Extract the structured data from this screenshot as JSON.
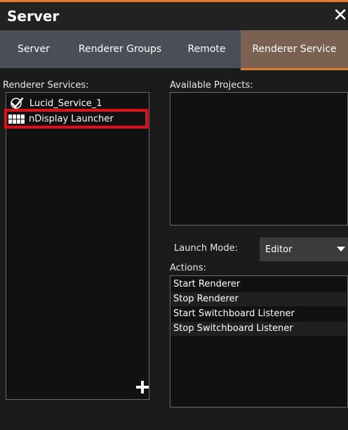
{
  "window": {
    "title": "Server",
    "close_glyph": "✕"
  },
  "tabs": [
    {
      "label": "Server",
      "active": false
    },
    {
      "label": "Renderer Groups",
      "active": false
    },
    {
      "label": "Remote",
      "active": false
    },
    {
      "label": "Renderer Service",
      "active": true
    }
  ],
  "renderer_services": {
    "label": "Renderer Services:",
    "items": [
      {
        "label": "Lucid_Service_1",
        "icon": "checkmark-icon"
      },
      {
        "label": "nDisplay Launcher",
        "icon": "grid-icon",
        "highlighted": true
      }
    ]
  },
  "available_projects": {
    "label": "Available Projects:"
  },
  "launch_mode": {
    "label": "Launch Mode:",
    "selected": "Editor"
  },
  "actions": {
    "label": "Actions:",
    "items": [
      "Start Renderer",
      "Stop Renderer",
      "Start Switchboard Listener",
      "Stop Switchboard Listener"
    ]
  },
  "colors": {
    "accent": "#e07b2a",
    "active_tab": "#7a6152",
    "tabbar": "#4a4e56",
    "highlight_box": "#e0101a"
  }
}
